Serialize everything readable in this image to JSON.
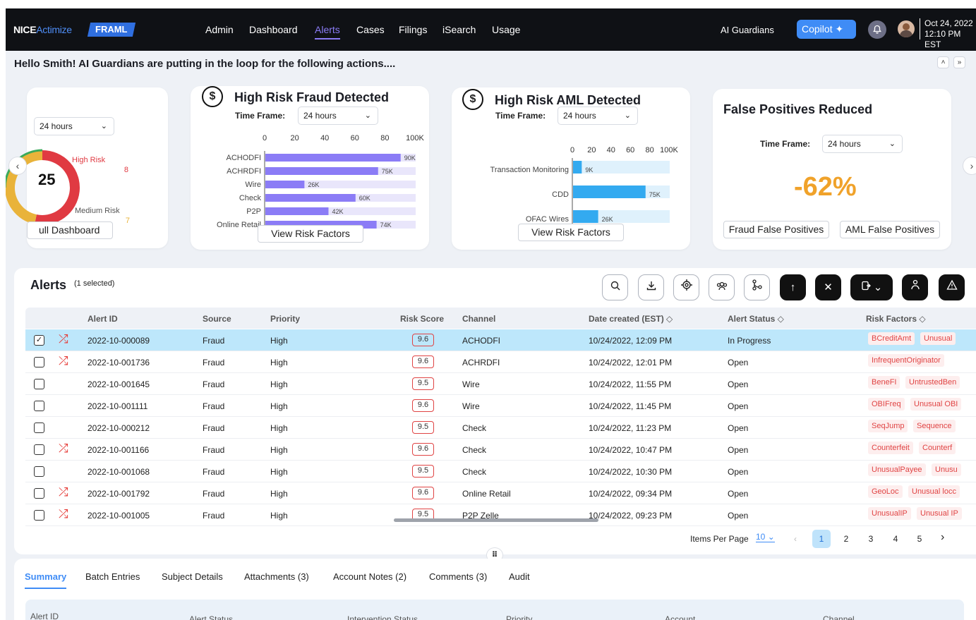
{
  "topbar": {
    "logo_nice": "NICE",
    "logo_actimize": "Actimize",
    "product": "FRAML",
    "nav": [
      "Admin",
      "Dashboard",
      "Alerts",
      "Cases",
      "Filings",
      "iSearch",
      "Usage"
    ],
    "active_nav": "Alerts",
    "ai_guardians": "AI Guardians",
    "copilot": "Copilot ✦",
    "date": "Oct 24, 2022",
    "time": "12:10 PM EST"
  },
  "greeting": "Hello Smith! AI Guardians are putting in the loop for the following actions....",
  "risk_card": {
    "timeframe": "24 hours",
    "total": "25",
    "high_label": "High Risk",
    "high_value": "8",
    "medium_label": "Medium Risk",
    "medium_value": "7",
    "link": "ull Dashboard"
  },
  "fraud_card": {
    "title": "High Risk Fraud Detected",
    "timeframe_label": "Time Frame:",
    "timeframe": "24 hours",
    "button": "View Risk Factors"
  },
  "aml_card": {
    "title": "High Risk AML Detected",
    "timeframe_label": "Time Frame:",
    "timeframe": "24 hours",
    "button": "View Risk Factors"
  },
  "fp_card": {
    "title": "False Positives Reduced",
    "timeframe_label": "Time Frame:",
    "timeframe": "24 hours",
    "value": "-62%",
    "btn_fraud": "Fraud False Positives",
    "btn_aml": "AML False Positives"
  },
  "chart_data": [
    {
      "type": "bar",
      "orientation": "horizontal",
      "categories": [
        "ACHODFI",
        "ACHRDFI",
        "Wire",
        "Check",
        "P2P",
        "Online Retail"
      ],
      "values": [
        90,
        75,
        26,
        60,
        42,
        74
      ],
      "data_labels": [
        "90K",
        "75K",
        "26K",
        "60K",
        "42K",
        "74K"
      ],
      "xticks": [
        "0",
        "20",
        "40",
        "60",
        "80",
        "100K"
      ],
      "xlim": [
        0,
        100
      ],
      "color": "#8b7cf6",
      "track_color": "#e9e6fb"
    },
    {
      "type": "bar",
      "orientation": "horizontal",
      "categories": [
        "Transaction Monitoring",
        "CDD",
        "OFAC Wires"
      ],
      "values": [
        9,
        75,
        26
      ],
      "data_labels": [
        "9K",
        "75K",
        "26K"
      ],
      "xticks": [
        "0",
        "20",
        "40",
        "60",
        "80",
        "100K"
      ],
      "xlim": [
        0,
        100
      ],
      "color": "#33aaf0",
      "track_color": "#dff1fc"
    },
    {
      "type": "pie",
      "categories": [
        "High Risk",
        "Medium Risk"
      ],
      "values": [
        8,
        7
      ],
      "colors": [
        "#e03a42",
        "#e9b33a"
      ]
    }
  ],
  "alerts": {
    "title": "Alerts",
    "selected": "(1 selected)",
    "columns": [
      "Alert ID",
      "Source",
      "Priority",
      "Risk Score",
      "Channel",
      "Date created (EST) ◇",
      "Alert Status ◇",
      "Risk Factors ◇"
    ],
    "rows": [
      {
        "id": "2022-10-000089",
        "source": "Fraud",
        "priority": "High",
        "score": "9.6",
        "channel": "ACHODFI",
        "date": "10/24/2022, 12:09 PM",
        "status": "In Progress",
        "rf1": "BCreditAmt",
        "rf2": "Unusual"
      },
      {
        "id": "2022-10-001736",
        "source": "Fraud",
        "priority": "High",
        "score": "9.6",
        "channel": "ACHRDFI",
        "date": "10/24/2022, 12:01 PM",
        "status": "Open",
        "rf1": "InfrequentOriginator",
        "rf2": ""
      },
      {
        "id": "2022-10-001645",
        "source": "Fraud",
        "priority": "High",
        "score": "9.5",
        "channel": "Wire",
        "date": "10/24/2022, 11:55 PM",
        "status": "Open",
        "rf1": "BeneFI",
        "rf2": "UntrustedBen"
      },
      {
        "id": "2022-10-001111",
        "source": "Fraud",
        "priority": "High",
        "score": "9.6",
        "channel": "Wire",
        "date": "10/24/2022, 11:45 PM",
        "status": "Open",
        "rf1": "OBIFreq",
        "rf2": "Unusual OBI"
      },
      {
        "id": "2022-10-000212",
        "source": "Fraud",
        "priority": "High",
        "score": "9.5",
        "channel": "Check",
        "date": "10/24/2022, 11:23 PM",
        "status": "Open",
        "rf1": "SeqJump",
        "rf2": "Sequence"
      },
      {
        "id": "2022-10-001166",
        "source": "Fraud",
        "priority": "High",
        "score": "9.6",
        "channel": "Check",
        "date": "10/24/2022, 10:47 PM",
        "status": "Open",
        "rf1": "Counterfeit",
        "rf2": "Counterf"
      },
      {
        "id": "2022-10-001068",
        "source": "Fraud",
        "priority": "High",
        "score": "9.5",
        "channel": "Check",
        "date": "10/24/2022, 10:30 PM",
        "status": "Open",
        "rf1": "UnusualPayee",
        "rf2": "Unusu"
      },
      {
        "id": "2022-10-001792",
        "source": "Fraud",
        "priority": "High",
        "score": "9.6",
        "channel": "Online Retail",
        "date": "10/24/2022, 09:34 PM",
        "status": "Open",
        "rf1": "GeoLoc",
        "rf2": "Unusual locc"
      },
      {
        "id": "2022-10-001005",
        "source": "Fraud",
        "priority": "High",
        "score": "9.5",
        "channel": "P2P Zelle",
        "date": "10/24/2022, 09:23 PM",
        "status": "Open",
        "rf1": "UnusualIP",
        "rf2": "Unusual IP"
      }
    ],
    "items_per_page_label": "Items Per Page",
    "items_per_page": "10",
    "pages": [
      "1",
      "2",
      "3",
      "4",
      "5"
    ]
  },
  "bottom_tabs": [
    "Summary",
    "Batch Entries",
    "Subject Details",
    "Attachments (3)",
    "Account Notes (2)",
    "Comments (3)",
    "Audit"
  ],
  "summary_cols": [
    "Alert ID",
    "Alert Status",
    "Intervention Status",
    "Priority",
    "Account",
    "Channel"
  ]
}
